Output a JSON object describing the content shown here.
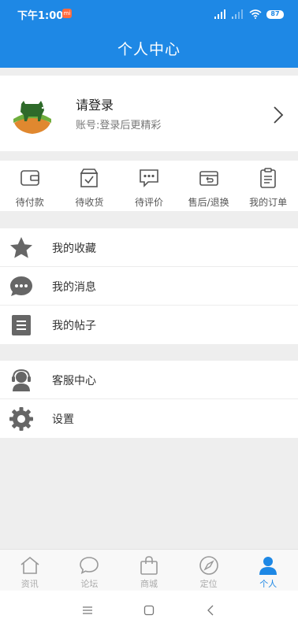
{
  "status_bar": {
    "time": "下午1:00",
    "mi": "mi",
    "battery": "87"
  },
  "header": {
    "title": "个人中心"
  },
  "profile": {
    "name": "请登录",
    "subtitle": "账号:登录后更精彩"
  },
  "orders": [
    {
      "label": "待付款",
      "icon": "wallet-icon"
    },
    {
      "label": "待收货",
      "icon": "box-check-icon"
    },
    {
      "label": "待评价",
      "icon": "comment-dots-icon"
    },
    {
      "label": "售后/退换",
      "icon": "return-box-icon"
    },
    {
      "label": "我的订单",
      "icon": "clipboard-icon"
    }
  ],
  "menu_group_1": [
    {
      "label": "我的收藏",
      "icon": "star-icon"
    },
    {
      "label": "我的消息",
      "icon": "message-icon"
    },
    {
      "label": "我的帖子",
      "icon": "post-list-icon"
    }
  ],
  "menu_group_2": [
    {
      "label": "客服中心",
      "icon": "headset-icon"
    },
    {
      "label": "设置",
      "icon": "gear-icon"
    }
  ],
  "tabs": [
    {
      "label": "资讯",
      "icon": "home-icon"
    },
    {
      "label": "论坛",
      "icon": "chat-bubble-icon"
    },
    {
      "label": "商城",
      "icon": "shopping-bag-icon"
    },
    {
      "label": "定位",
      "icon": "compass-icon"
    },
    {
      "label": "个人",
      "icon": "person-icon",
      "active": true
    }
  ],
  "colors": {
    "primary": "#1e88e5",
    "icon_gray": "#666666",
    "tab_inactive": "#aaaaaa"
  }
}
